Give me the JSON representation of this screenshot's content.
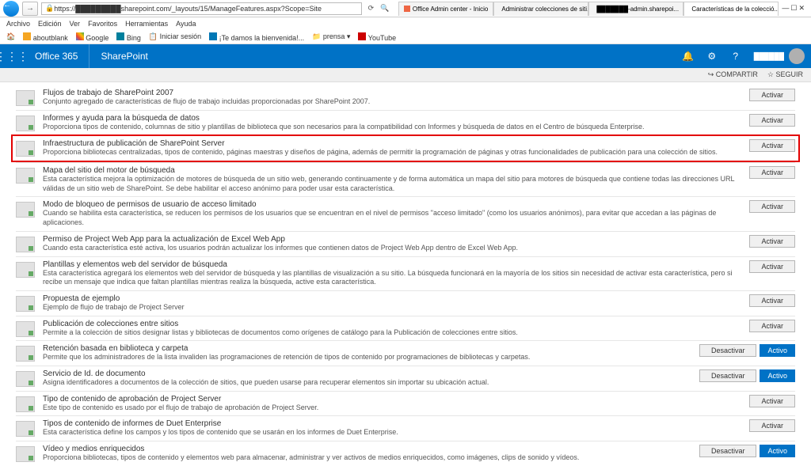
{
  "browser": {
    "url": "https://█████████sharepoint.com/_layouts/15/ManageFeatures.aspx?Scope=Site",
    "menus": [
      "Archivo",
      "Edición",
      "Ver",
      "Favoritos",
      "Herramientas",
      "Ayuda"
    ],
    "bookmarks": [
      "aboutblank",
      "Google",
      "Bing",
      "Iniciar sesión",
      "¡Te damos la bienvenida!...",
      "prensa ▾",
      "YouTube"
    ],
    "tabs": [
      {
        "label": "Office Admin center - Inicio"
      },
      {
        "label": "Administrar colecciones de siti..."
      },
      {
        "label": "███████-admin.sharepoi..."
      },
      {
        "label": "Características de la colecció..."
      }
    ]
  },
  "suite": {
    "o365": "Office 365",
    "app": "SharePoint",
    "user": "██████"
  },
  "sharebar": {
    "share": "COMPARTIR",
    "follow": "SEGUIR"
  },
  "btns": {
    "activate": "Activar",
    "deactivate": "Desactivar",
    "active": "Activo"
  },
  "features": [
    {
      "title": "Flujos de trabajo de SharePoint 2007",
      "desc": "Conjunto agregado de características de flujo de trabajo incluidas proporcionadas por SharePoint 2007.",
      "a": [
        "act"
      ]
    },
    {
      "title": "Informes y ayuda para la búsqueda de datos",
      "desc": "Proporciona tipos de contenido, columnas de sitio y plantillas de biblioteca que son necesarios para la compatibilidad con Informes y búsqueda de datos en el Centro de búsqueda Enterprise.",
      "a": [
        "act"
      ]
    },
    {
      "title": "Infraestructura de publicación de SharePoint Server",
      "desc": "Proporciona bibliotecas centralizadas, tipos de contenido, páginas maestras y diseños de página, además de permitir la programación de páginas y otras funcionalidades de publicación para una colección de sitios.",
      "a": [
        "act"
      ],
      "hl": true
    },
    {
      "title": "Mapa del sitio del motor de búsqueda",
      "desc": "Esta característica mejora la optimización de motores de búsqueda de un sitio web, generando continuamente y de forma automática un mapa del sitio para motores de búsqueda que contiene todas las direcciones URL válidas de un sitio web de SharePoint. Se debe habilitar el acceso anónimo para poder usar esta característica.",
      "a": [
        "act"
      ]
    },
    {
      "title": "Modo de bloqueo de permisos de usuario de acceso limitado",
      "desc": "Cuando se habilita esta característica, se reducen los permisos de los usuarios que se encuentran en el nivel de permisos \"acceso limitado\" (como los usuarios anónimos), para evitar que accedan a las páginas de aplicaciones.",
      "a": [
        "act"
      ]
    },
    {
      "title": "Permiso de Project Web App para la actualización de Excel Web App",
      "desc": "Cuando esta característica esté activa, los usuarios podrán actualizar los informes que contienen datos de Project Web App dentro de Excel Web App.",
      "a": [
        "act"
      ]
    },
    {
      "title": "Plantillas y elementos web del servidor de búsqueda",
      "desc": "Esta característica agregará los elementos web del servidor de búsqueda y las plantillas de visualización a su sitio. La búsqueda funcionará en la mayoría de los sitios sin necesidad de activar esta característica, pero si recibe un mensaje que indica que faltan plantillas mientras realiza la búsqueda, active esta característica.",
      "a": [
        "act"
      ]
    },
    {
      "title": "Propuesta de ejemplo",
      "desc": "Ejemplo de flujo de trabajo de Project Server",
      "a": [
        "act"
      ]
    },
    {
      "title": "Publicación de colecciones entre sitios",
      "desc": "Permite a la colección de sitios designar listas y bibliotecas de documentos como orígenes de catálogo para la Publicación de colecciones entre sitios.",
      "a": [
        "act"
      ]
    },
    {
      "title": "Retención basada en biblioteca y carpeta",
      "desc": "Permite que los administradores de la lista invaliden las programaciones de retención de tipos de contenido por programaciones de bibliotecas y carpetas.",
      "a": [
        "deact",
        "active"
      ]
    },
    {
      "title": "Servicio de Id. de documento",
      "desc": "Asigna identificadores a documentos de la colección de sitios, que pueden usarse para recuperar elementos sin importar su ubicación actual.",
      "a": [
        "deact",
        "active"
      ]
    },
    {
      "title": "Tipo de contenido de aprobación de Project Server",
      "desc": "Este tipo de contenido es usado por el flujo de trabajo de aprobación de Project Server.",
      "a": [
        "act"
      ]
    },
    {
      "title": "Tipos de contenido de informes de Duet Enterprise",
      "desc": "Esta característica define los campos y los tipos de contenido que se usarán en los informes de Duet Enterprise.",
      "a": [
        "act"
      ]
    },
    {
      "title": "Vídeo y medios enriquecidos",
      "desc": "Proporciona bibliotecas, tipos de contenido y elementos web para almacenar, administrar y ver activos de medios enriquecidos, como imágenes, clips de sonido y vídeos.",
      "a": [
        "deact",
        "active"
      ]
    }
  ]
}
